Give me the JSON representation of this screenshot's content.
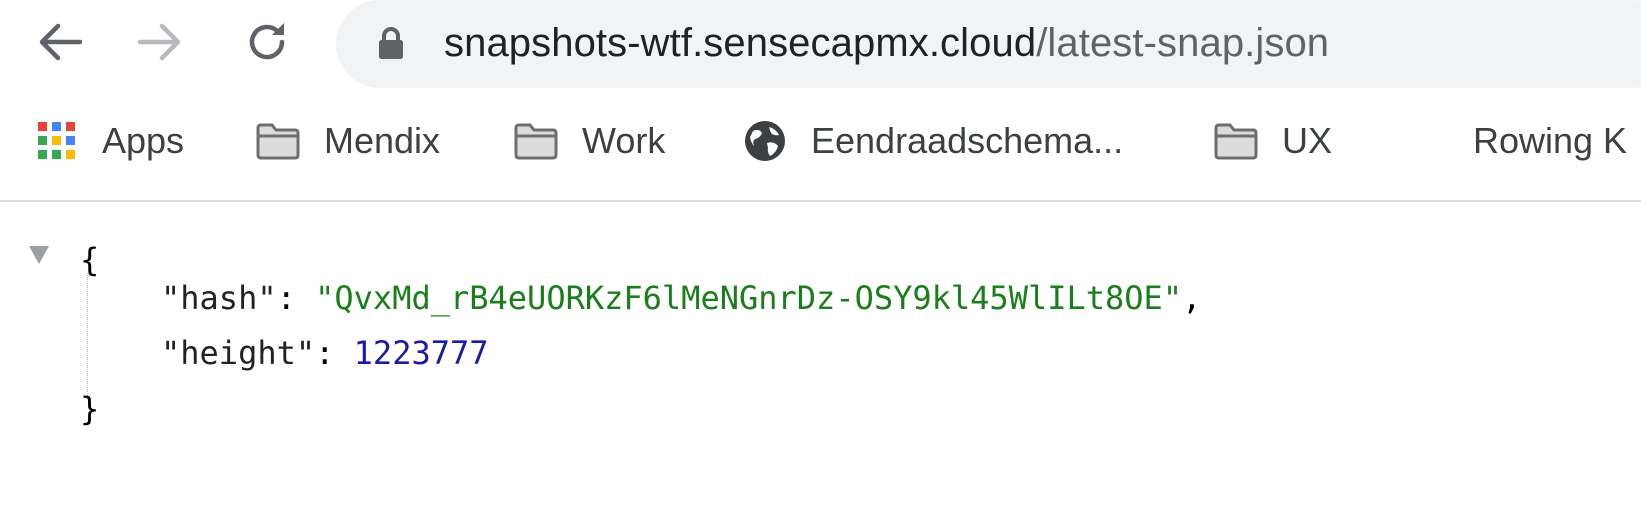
{
  "browser": {
    "url_host": "snapshots-wtf.sensecapmx.cloud",
    "url_path": "/latest-snap.json",
    "nav": {
      "back_icon": "arrow-left-icon",
      "forward_icon": "arrow-right-icon",
      "reload_icon": "reload-icon",
      "lock_icon": "lock-icon"
    }
  },
  "bookmarks": [
    {
      "label": "Apps",
      "icon": "apps-grid-icon"
    },
    {
      "label": "Mendix",
      "icon": "folder-icon"
    },
    {
      "label": "Work",
      "icon": "folder-icon"
    },
    {
      "label": "Eendraadschema...",
      "icon": "globe-icon"
    },
    {
      "label": "UX",
      "icon": "folder-icon"
    },
    {
      "label": "Rowing K",
      "icon": ""
    }
  ],
  "json_view": {
    "open_brace": "{",
    "close_brace": "}",
    "entries": [
      {
        "key": "\"hash\"",
        "value": "\"QvxMd_rB4eUORKzF6lMeNGnrDz-OSY9kl45WlILt8OE\"",
        "type": "string",
        "trailing": ","
      },
      {
        "key": "\"height\"",
        "value": "1223777",
        "type": "number",
        "trailing": ""
      }
    ]
  },
  "colors": {
    "string": "#1a7f1a",
    "number": "#1a1aa6",
    "omnibox_bg": "#f1f3f4"
  }
}
